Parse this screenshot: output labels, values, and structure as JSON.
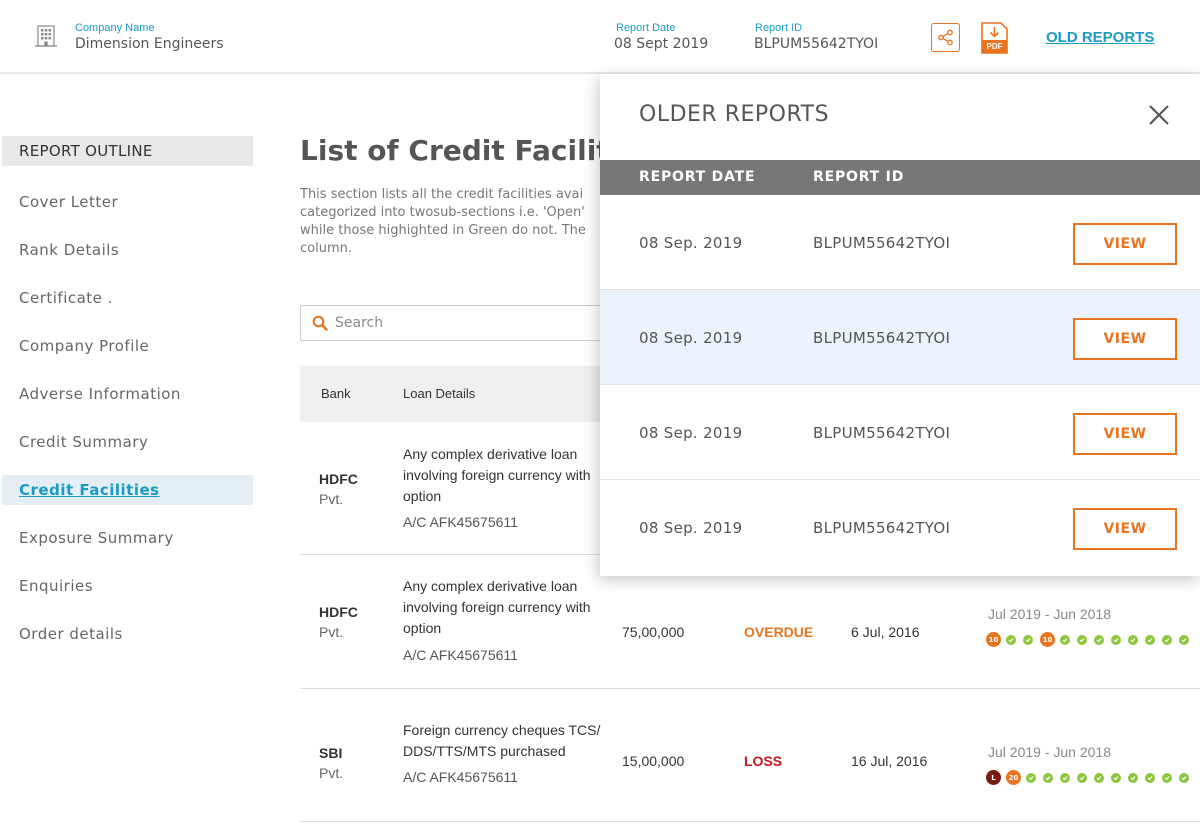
{
  "header": {
    "company_label": "Company Name",
    "company_name": "Dimension Engineers",
    "report_date_label": "Report Date",
    "report_date": "08 Sept 2019",
    "report_id_label": "Report ID",
    "report_id": "BLPUM55642TYOI",
    "pdf_label": "PDF",
    "old_reports": "OLD REPORTS"
  },
  "sidebar": {
    "heading": "REPORT OUTLINE",
    "items": [
      {
        "label": "Cover Letter"
      },
      {
        "label": "Rank Details"
      },
      {
        "label": "Certificate ."
      },
      {
        "label": "Company Profile"
      },
      {
        "label": "Adverse Information"
      },
      {
        "label": "Credit Summary"
      },
      {
        "label": "Credit Facilities"
      },
      {
        "label": "Exposure Summary"
      },
      {
        "label": "Enquiries"
      },
      {
        "label": "Order details"
      }
    ],
    "active_index": 6
  },
  "main": {
    "title": "List of Credit Facilit",
    "description": [
      "This section lists all the credit facilities avai",
      "categorized into twosub-sections i.e. 'Open'",
      "while those highighted in Green do not. The",
      "column."
    ],
    "search_placeholder": "Search",
    "columns": {
      "bank": "Bank",
      "loan_details": "Loan Details"
    },
    "rows": [
      {
        "bank": "HDFC",
        "bank_type": "Pvt.",
        "loan": "Any complex derivative loan involving foreign currency with option",
        "account": "A/C AFK45675611",
        "amount": "",
        "status": "",
        "date": "",
        "period": ""
      },
      {
        "bank": "HDFC",
        "bank_type": "Pvt.",
        "loan": "Any complex derivative loan involving foreign currency with option",
        "account": "A/C AFK45675611",
        "amount": "75,00,000",
        "status": "OVERDUE",
        "date": "6 Jul, 2016",
        "period": "Jul 2019 - Jun 2018",
        "markers": [
          {
            "kind": "overdue",
            "label": "10"
          },
          {
            "kind": "ok",
            "label": ""
          },
          {
            "kind": "ok",
            "label": ""
          },
          {
            "kind": "overdue",
            "label": "10"
          },
          {
            "kind": "ok",
            "label": ""
          },
          {
            "kind": "ok",
            "label": ""
          },
          {
            "kind": "ok",
            "label": ""
          },
          {
            "kind": "ok",
            "label": ""
          },
          {
            "kind": "ok",
            "label": ""
          },
          {
            "kind": "ok",
            "label": ""
          },
          {
            "kind": "ok",
            "label": ""
          },
          {
            "kind": "ok",
            "label": ""
          }
        ]
      },
      {
        "bank": "SBI",
        "bank_type": "Pvt.",
        "loan": "Foreign currency cheques TCS/ DDS/TTS/MTS purchased",
        "account": "A/C AFK45675611",
        "amount": "15,00,000",
        "status": "LOSS",
        "date": "16 Jul, 2016",
        "period": "Jul 2019 - Jun 2018",
        "markers": [
          {
            "kind": "loss",
            "label": "L"
          },
          {
            "kind": "overdue",
            "label": "20"
          },
          {
            "kind": "ok",
            "label": ""
          },
          {
            "kind": "ok",
            "label": ""
          },
          {
            "kind": "ok",
            "label": ""
          },
          {
            "kind": "ok",
            "label": ""
          },
          {
            "kind": "ok",
            "label": ""
          },
          {
            "kind": "ok",
            "label": ""
          },
          {
            "kind": "ok",
            "label": ""
          },
          {
            "kind": "ok",
            "label": ""
          },
          {
            "kind": "ok",
            "label": ""
          },
          {
            "kind": "ok",
            "label": ""
          }
        ]
      }
    ]
  },
  "older_reports": {
    "title": "OLDER REPORTS",
    "col_date": "REPORT DATE",
    "col_id": "REPORT ID",
    "view_label": "VIEW",
    "highlighted_index": 1,
    "rows": [
      {
        "date": "08 Sep. 2019",
        "id": "BLPUM55642TYOI"
      },
      {
        "date": "08 Sep. 2019",
        "id": "BLPUM55642TYOI"
      },
      {
        "date": "08 Sep. 2019",
        "id": "BLPUM55642TYOI"
      },
      {
        "date": "08 Sep. 2019",
        "id": "BLPUM55642TYOI"
      }
    ]
  },
  "colors": {
    "accent_blue": "#1a9bc4",
    "accent_orange": "#e8741f",
    "status_overdue": "#e8741f",
    "status_loss": "#c0161d",
    "marker_ok": "#8cc63f",
    "marker_loss": "#7a1a10"
  }
}
